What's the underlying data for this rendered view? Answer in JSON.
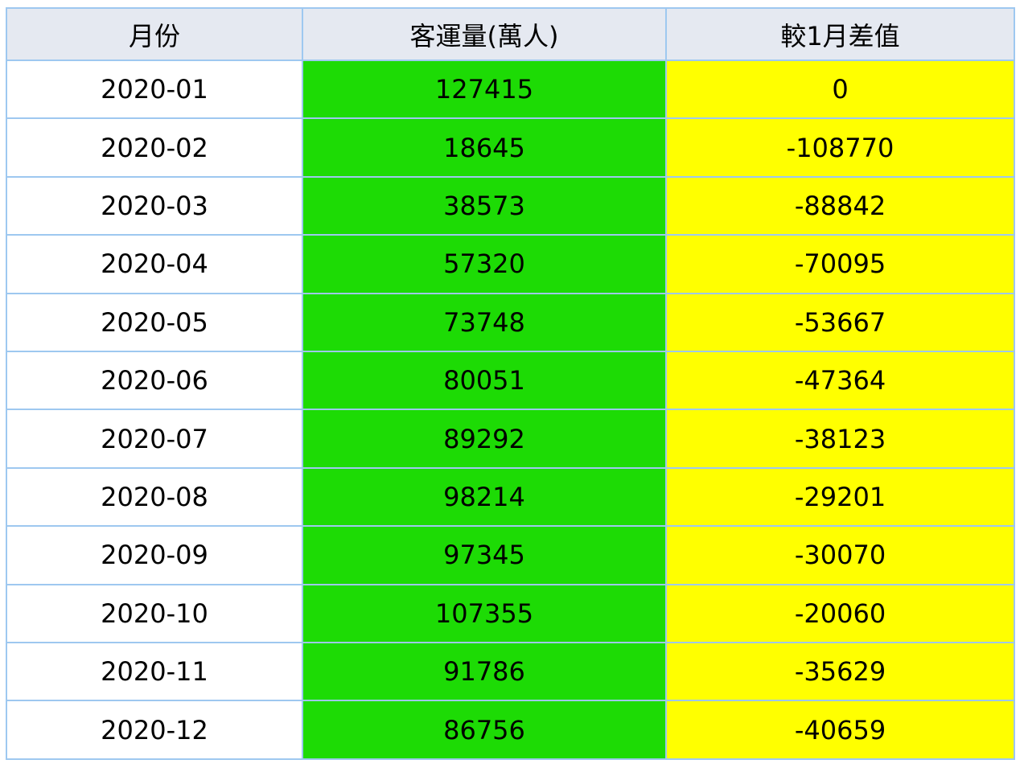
{
  "chart_data": {
    "type": "table",
    "columns": [
      "月份",
      "客運量(萬人)",
      "較1月差值"
    ],
    "rows": [
      [
        "2020-01",
        "127415",
        "0"
      ],
      [
        "2020-02",
        "18645",
        "-108770"
      ],
      [
        "2020-03",
        "38573",
        "-88842"
      ],
      [
        "2020-04",
        "57320",
        "-70095"
      ],
      [
        "2020-05",
        "73748",
        "-53667"
      ],
      [
        "2020-06",
        "80051",
        "-47364"
      ],
      [
        "2020-07",
        "89292",
        "-38123"
      ],
      [
        "2020-08",
        "98214",
        "-29201"
      ],
      [
        "2020-09",
        "97345",
        "-30070"
      ],
      [
        "2020-10",
        "107355",
        "-20060"
      ],
      [
        "2020-11",
        "91786",
        "-35629"
      ],
      [
        "2020-12",
        "86756",
        "-40659"
      ]
    ],
    "colors": {
      "header_bg": "#e5e9f1",
      "month_bg": "#ffffff",
      "volume_bg": "#1ddb05",
      "diff_bg": "#ffff00",
      "border": "#9ec8f0"
    }
  }
}
